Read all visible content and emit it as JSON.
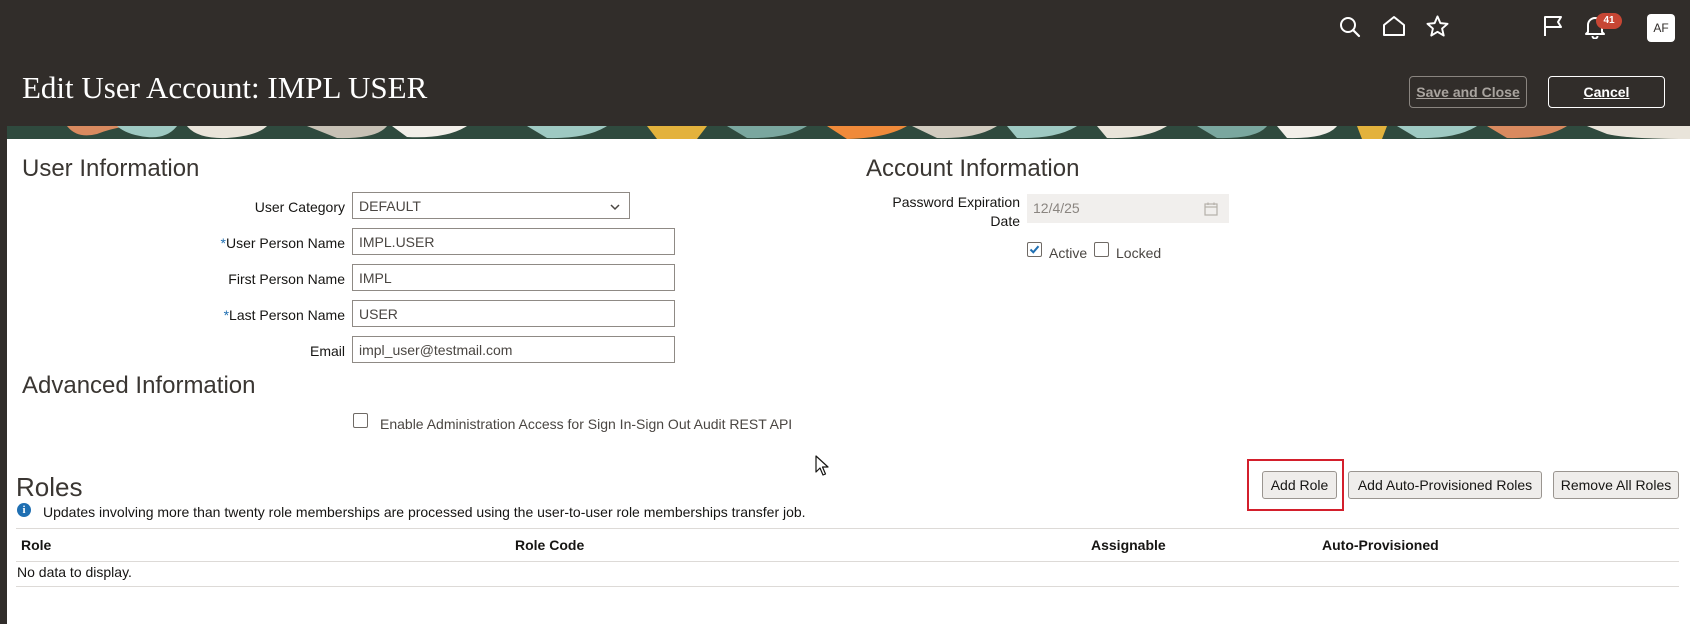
{
  "header": {
    "title": "Edit User Account: IMPL USER",
    "notification_count": "41",
    "avatar_initials": "AF",
    "save_label": "Save and Close",
    "cancel_label": "Cancel",
    "icons": [
      "search-icon",
      "home-icon",
      "star-icon",
      "flag-icon",
      "bell-icon"
    ]
  },
  "user_info": {
    "title": "User Information",
    "category": {
      "label": "User Category",
      "value": "DEFAULT"
    },
    "person_name": {
      "required_mark": "*",
      "label": "User Person Name",
      "value": "IMPL.USER"
    },
    "first_name": {
      "label": "First Person Name",
      "value": "IMPL"
    },
    "last_name": {
      "required_mark": "*",
      "label": "Last Person Name",
      "value": "USER"
    },
    "email": {
      "label": "Email",
      "value": "impl_user@testmail.com"
    }
  },
  "account_info": {
    "title": "Account Information",
    "password_label_line1": "Password Expiration",
    "password_label_line2": "Date",
    "password_value": "12/4/25",
    "active_label": "Active",
    "active_checked": true,
    "locked_label": "Locked",
    "locked_checked": false
  },
  "advanced_info": {
    "title": "Advanced Information",
    "admin_access_label": "Enable Administration Access for Sign In-Sign Out Audit REST API",
    "admin_access_checked": false
  },
  "roles": {
    "title": "Roles",
    "info_text": "Updates involving more than twenty role memberships are processed using the user-to-user role memberships transfer job.",
    "add_role_label": "Add Role",
    "add_auto_label": "Add Auto-Provisioned Roles",
    "remove_all_label": "Remove All Roles",
    "columns": [
      "Role",
      "Role Code",
      "Assignable",
      "Auto-Provisioned"
    ],
    "empty_text": "No data to display."
  },
  "colors": {
    "header_bg": "#312d2a",
    "accent_blue": "#1f6fb2",
    "highlight_red": "#d31f2c",
    "badge_red": "#c74634"
  }
}
